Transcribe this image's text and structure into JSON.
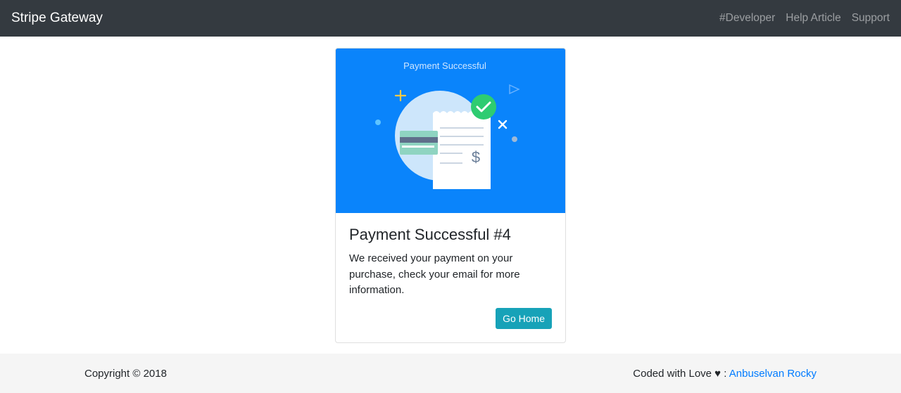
{
  "navbar": {
    "brand": "Stripe Gateway",
    "links": [
      "#Developer",
      "Help Article",
      "Support"
    ]
  },
  "card": {
    "image_caption": "Payment Successful",
    "title": "Payment Successful #4",
    "text": "We received your payment on your purchase, check your email for more information.",
    "button": "Go Home"
  },
  "footer": {
    "copyright": "Copyright © 2018",
    "credit_prefix": "Coded with Love ♥ : ",
    "credit_link": "Anbuselvan Rocky"
  },
  "colors": {
    "navbar_bg": "#343a40",
    "image_bg": "#0a84fb",
    "button_bg": "#17a2b8",
    "link": "#007bff",
    "footer_bg": "#f5f5f5",
    "check_green": "#2ecc71"
  },
  "icons": [
    "payment-success-illustration",
    "check-circle-icon",
    "dollar-sign-icon",
    "credit-card-icon",
    "plus-icon",
    "close-icon",
    "play-icon"
  ]
}
